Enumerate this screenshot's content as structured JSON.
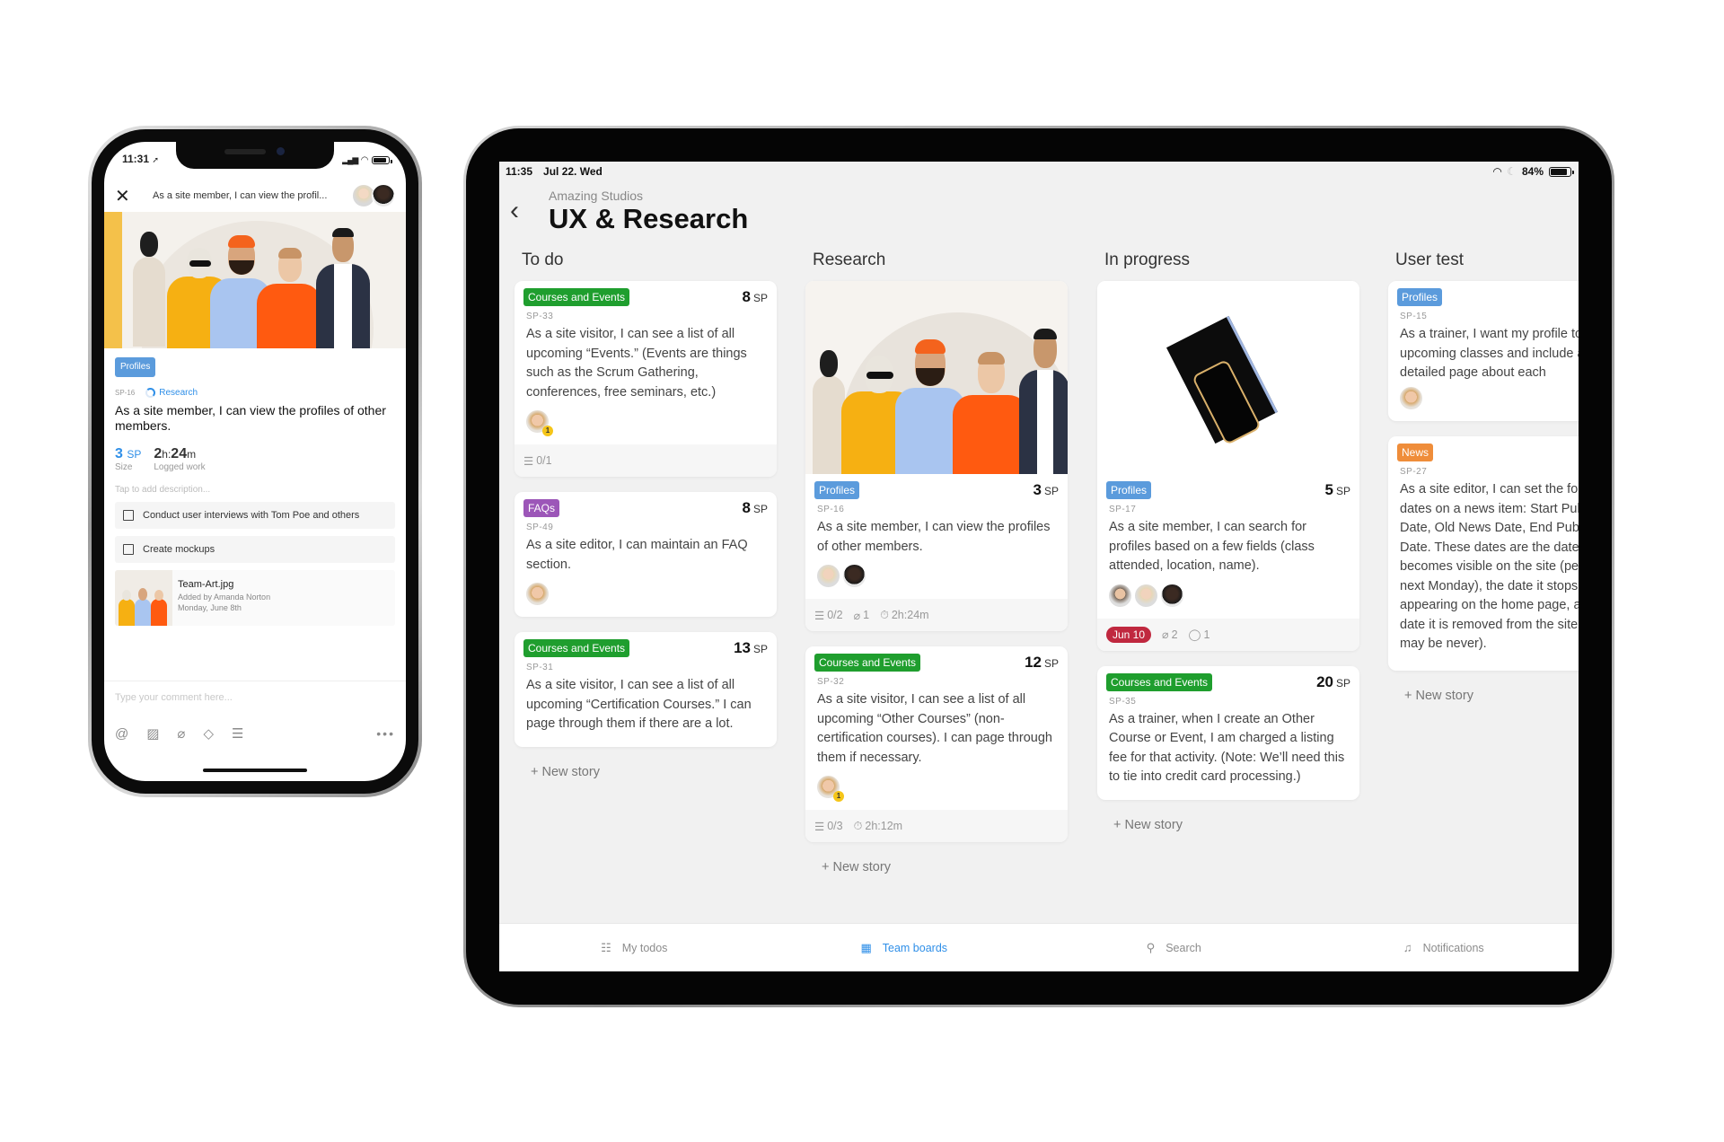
{
  "phone": {
    "status_time": "11:31",
    "header_title": "As a site member, I can view the profil...",
    "tag": {
      "label": "Profiles",
      "color": "#5b9bdc"
    },
    "story_id": "SP-16",
    "status_label": "Research",
    "title": "As a site member, I can view the profiles of other members.",
    "size_value": "3",
    "size_unit": "SP",
    "size_label": "Size",
    "logged_hours": "2",
    "logged_h_unit": "h:",
    "logged_minutes": "24",
    "logged_m_unit": "m",
    "logged_label": "Logged work",
    "description_placeholder": "Tap to add description...",
    "checklist": [
      {
        "label": "Conduct user interviews with Tom Poe and others",
        "checked": false
      },
      {
        "label": "Create mockups",
        "checked": false
      }
    ],
    "attachment": {
      "filename": "Team-Art.jpg",
      "added_by": "Added by Amanda Norton",
      "date": "Monday, June 8th"
    },
    "comment_placeholder": "Type your comment here...",
    "toolbar_icons": [
      "at-icon",
      "image-icon",
      "paperclip-icon",
      "tag-icon",
      "checklist-icon",
      "more-icon"
    ]
  },
  "tablet": {
    "status_time": "11:35",
    "status_date": "Jul 22. Wed",
    "battery": "84%",
    "battery_level": 0.84,
    "org": "Amazing Studios",
    "board_title": "UX & Research",
    "new_story_label": "+ New story",
    "columns": [
      {
        "title": "To do",
        "cards": [
          {
            "tag": "Courses and Events",
            "tag_color": "#1f9e2e",
            "points": "8",
            "unit": "SP",
            "id": "SP-33",
            "text": "As a site visitor, I can see a list of all upcoming “Events.” (Events are things such as the Scrum Gathering, conferences, free seminars, etc.)",
            "assignee_badge": "1",
            "checklist": "0/1"
          },
          {
            "tag": "FAQs",
            "tag_color": "#9c56b8",
            "points": "8",
            "unit": "SP",
            "id": "SP-49",
            "text": "As a site editor, I can maintain an FAQ section."
          },
          {
            "tag": "Courses and Events",
            "tag_color": "#1f9e2e",
            "points": "13",
            "unit": "SP",
            "id": "SP-31",
            "text": "As a site visitor, I can see a list of all upcoming “Certification Courses.” I can page through them if there are a lot."
          }
        ]
      },
      {
        "title": "Research",
        "cards": [
          {
            "tag": "Profiles",
            "tag_color": "#5b9bdc",
            "points": "3",
            "unit": "SP",
            "id": "SP-16",
            "text": "As a site member, I can view the profiles of other members.",
            "checklist": "0/2",
            "attachments": "1",
            "time": "2h:24m"
          },
          {
            "tag": "Courses and Events",
            "tag_color": "#1f9e2e",
            "points": "12",
            "unit": "SP",
            "id": "SP-32",
            "text": "As a site visitor, I can see a list of all upcoming “Other Courses” (non-certification courses). I can page through them if necessary.",
            "assignee_badge": "1",
            "checklist": "0/3",
            "time": "2h:12m"
          }
        ]
      },
      {
        "title": "In progress",
        "cards": [
          {
            "tag": "Profiles",
            "tag_color": "#5b9bdc",
            "points": "5",
            "unit": "SP",
            "id": "SP-17",
            "text": "As a site member, I can search for profiles based on a few fields (class attended, location, name).",
            "due": "Jun 10",
            "attachments": "2",
            "comments": "1"
          },
          {
            "tag": "Courses and Events",
            "tag_color": "#1f9e2e",
            "points": "20",
            "unit": "SP",
            "id": "SP-35",
            "text": "As a trainer, when I create an Other Course or Event, I am charged a listing fee for that activity. (Note: We’ll need this to tie into credit card processing.)"
          }
        ]
      },
      {
        "title": "User test",
        "cards": [
          {
            "tag": "Profiles",
            "tag_color": "#5b9bdc",
            "id": "SP-15",
            "text": "As a trainer, I want my profile to list my upcoming classes and include a link to a detailed page about each"
          },
          {
            "tag": "News",
            "tag_color": "#ef8d3a",
            "id": "SP-27",
            "text": "As a site editor, I can set the following dates on a news item: Start Publishing Date, Old News Date, End Publishing Date. These dates are the date an item becomes visible on the site (perhaps next Monday), the date it stops appearing on the home page, and the date it is removed from the site (which may be never)."
          }
        ]
      }
    ],
    "nav": [
      {
        "label": "My todos",
        "icon": "todos-icon",
        "active": false
      },
      {
        "label": "Team boards",
        "icon": "boards-icon",
        "active": true
      },
      {
        "label": "Search",
        "icon": "search-icon",
        "active": false
      },
      {
        "label": "Notifications",
        "icon": "bell-icon",
        "active": false
      }
    ]
  }
}
